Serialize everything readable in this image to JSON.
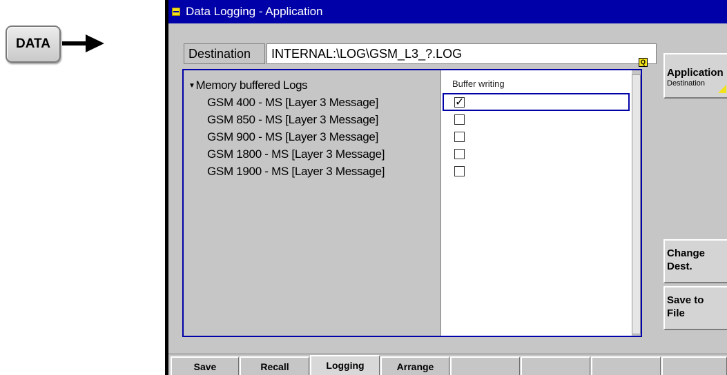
{
  "hardkey": {
    "label": "DATA"
  },
  "window": {
    "title": "Data Logging - Application"
  },
  "destination": {
    "label": "Destination",
    "value": "INTERNAL:\\LOG\\GSM_L3_?.LOG",
    "indicator": "Q"
  },
  "tree": {
    "header": "Memory buffered Logs",
    "items": [
      {
        "label": "GSM 400 - MS [Layer 3 Message]",
        "checked": true
      },
      {
        "label": "GSM 850 - MS [Layer 3 Message]",
        "checked": false
      },
      {
        "label": "GSM 900 - MS [Layer 3 Message]",
        "checked": false
      },
      {
        "label": "GSM 1800 - MS [Layer 3 Message]",
        "checked": false
      },
      {
        "label": "GSM 1900 - MS [Layer 3 Message]",
        "checked": false
      }
    ]
  },
  "columns": {
    "buffer_writing": "Buffer writing"
  },
  "softkeys": {
    "application": {
      "label": "Application",
      "sub": "Destination"
    },
    "change_dest": {
      "line1": "Change",
      "line2": "Dest."
    },
    "save_to_file": {
      "line1": "Save to",
      "line2": "File"
    }
  },
  "tabs": [
    "Save",
    "Recall",
    "Logging",
    "Arrange",
    "",
    "",
    "",
    "",
    ""
  ],
  "active_tab": "Logging",
  "colors": {
    "title_bar": "#0000a8",
    "screen_bg": "#c6c6c6",
    "indicator_yellow": "#f2e21a"
  }
}
